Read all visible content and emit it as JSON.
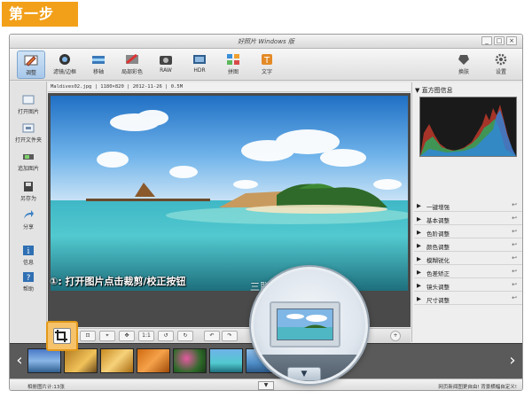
{
  "step_tag": "第一步",
  "window": {
    "title": "好照片 Windows 版",
    "controls": {
      "minimize": "_",
      "maximize": "□",
      "close": "×"
    }
  },
  "toolbar": {
    "items": [
      {
        "label": "调整",
        "icon": "adjust-icon",
        "active": true
      },
      {
        "label": "滤镜/边框",
        "icon": "filter-frame-icon"
      },
      {
        "label": "移轴",
        "icon": "tilt-shift-icon"
      },
      {
        "label": "局部彩色",
        "icon": "partial-color-icon"
      },
      {
        "label": "RAW",
        "icon": "raw-icon"
      },
      {
        "label": "HDR",
        "icon": "hdr-icon"
      },
      {
        "label": "拼图",
        "icon": "collage-icon"
      },
      {
        "label": "文字",
        "icon": "text-icon"
      }
    ],
    "right_items": [
      {
        "label": "换肤",
        "icon": "skin-icon"
      },
      {
        "label": "设置",
        "icon": "settings-icon"
      }
    ]
  },
  "sidebar": {
    "items": [
      {
        "label": "打开图片",
        "icon": "open-image-icon"
      },
      {
        "label": "打开文件夹",
        "icon": "open-folder-icon"
      },
      {
        "label": "追加图片",
        "icon": "append-image-icon"
      },
      {
        "label": "另存为",
        "icon": "save-as-icon"
      },
      {
        "label": "分享",
        "icon": "share-icon"
      },
      {
        "label": "信息",
        "icon": "info-icon"
      },
      {
        "label": "帮助",
        "icon": "help-icon"
      }
    ]
  },
  "image_info": "Maldives02.jpg | 1180×820 | 2012-11-26 | 0.5M",
  "right_panel": {
    "histogram_title": "直方图信息",
    "sections": [
      "一键增强",
      "基本调整",
      "色阶调整",
      "颜色调整",
      "模糊锐化",
      "色差矫正",
      "镜头调整",
      "尺寸调整"
    ]
  },
  "bottom_tools": {
    "one_to_one": "1:1"
  },
  "statusbar": {
    "left": "相册图片计:13张",
    "right": "网页新闻图更自由! 背景横幅自定义!"
  },
  "annotation": "①: 打开图片点击裁剪/校正按钮",
  "watermark": "三联网 3LIAN.COM",
  "colors": {
    "accent_orange": "#f2a019",
    "toolbar_active": "#a8c8ea"
  }
}
